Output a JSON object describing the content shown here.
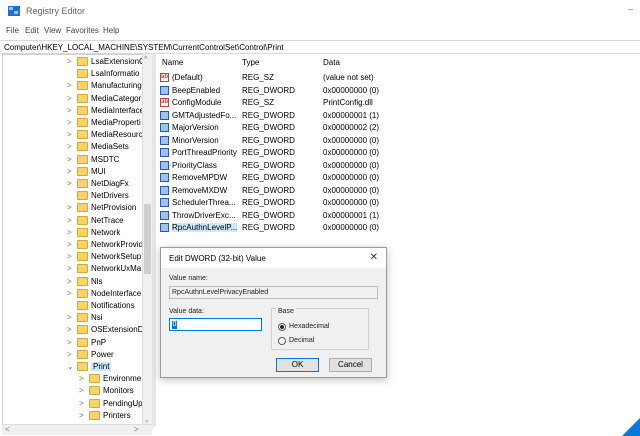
{
  "window": {
    "title": "Registry Editor",
    "controls": "–"
  },
  "menu": [
    "File",
    "Edit",
    "View",
    "Favorites",
    "Help"
  ],
  "address": "Computer\\HKEY_LOCAL_MACHINE\\SYSTEM\\CurrentControlSet\\Control\\Print",
  "tree": {
    "items": [
      {
        "label": "LsaExtensionC",
        "chev": ">"
      },
      {
        "label": "LsaInformatio",
        "chev": ""
      },
      {
        "label": "Manufacturing",
        "chev": ">"
      },
      {
        "label": "MediaCategor",
        "chev": ">"
      },
      {
        "label": "MediaInterface",
        "chev": ">"
      },
      {
        "label": "MediaProperti",
        "chev": ">"
      },
      {
        "label": "MediaResourc",
        "chev": ">"
      },
      {
        "label": "MediaSets",
        "chev": ">"
      },
      {
        "label": "MSDTC",
        "chev": ">"
      },
      {
        "label": "MUI",
        "chev": ">"
      },
      {
        "label": "NetDiagFx",
        "chev": ">"
      },
      {
        "label": "NetDrivers",
        "chev": ""
      },
      {
        "label": "NetProvision",
        "chev": ">"
      },
      {
        "label": "NetTrace",
        "chev": ">"
      },
      {
        "label": "Network",
        "chev": ">"
      },
      {
        "label": "NetworkProvid",
        "chev": ">"
      },
      {
        "label": "NetworkSetup",
        "chev": ">"
      },
      {
        "label": "NetworkUxMa",
        "chev": ">"
      },
      {
        "label": "Nls",
        "chev": ">"
      },
      {
        "label": "NodeInterface",
        "chev": ">"
      },
      {
        "label": "Notifications",
        "chev": ""
      },
      {
        "label": "Nsi",
        "chev": ">"
      },
      {
        "label": "OSExtensionD",
        "chev": ">"
      },
      {
        "label": "PnP",
        "chev": ">"
      },
      {
        "label": "Power",
        "chev": ">"
      },
      {
        "label": "Print",
        "chev": "⌄",
        "selected": true
      },
      {
        "label": "Environme",
        "chev": ">",
        "child": true
      },
      {
        "label": "Monitors",
        "chev": ">",
        "child": true
      },
      {
        "label": "PendingUp",
        "chev": ">",
        "child": true
      },
      {
        "label": "Printers",
        "chev": ">",
        "child": true
      }
    ],
    "scroll_up": "^",
    "scroll_down": "⌄",
    "scroll_left": "<",
    "scroll_right": ">"
  },
  "list": {
    "headers": {
      "name": "Name",
      "type": "Type",
      "data": "Data"
    },
    "rows": [
      {
        "icon": "sz",
        "name": "(Default)",
        "type": "REG_SZ",
        "data": "(value not set)"
      },
      {
        "icon": "bin",
        "name": "BeepEnabled",
        "type": "REG_DWORD",
        "data": "0x00000000 (0)"
      },
      {
        "icon": "sz",
        "name": "ConfigModule",
        "type": "REG_SZ",
        "data": "PrintConfig.dll"
      },
      {
        "icon": "bin",
        "name": "GMTAdjustedFo...",
        "type": "REG_DWORD",
        "data": "0x00000001 (1)"
      },
      {
        "icon": "bin",
        "name": "MajorVersion",
        "type": "REG_DWORD",
        "data": "0x00000002 (2)"
      },
      {
        "icon": "bin",
        "name": "MinorVersion",
        "type": "REG_DWORD",
        "data": "0x00000000 (0)"
      },
      {
        "icon": "bin",
        "name": "PortThreadPriority",
        "type": "REG_DWORD",
        "data": "0x00000000 (0)"
      },
      {
        "icon": "bin",
        "name": "PriorityClass",
        "type": "REG_DWORD",
        "data": "0x00000000 (0)"
      },
      {
        "icon": "bin",
        "name": "RemoveMPDW",
        "type": "REG_DWORD",
        "data": "0x00000000 (0)"
      },
      {
        "icon": "bin",
        "name": "RemoveMXDW",
        "type": "REG_DWORD",
        "data": "0x00000000 (0)"
      },
      {
        "icon": "bin",
        "name": "SchedulerThrea...",
        "type": "REG_DWORD",
        "data": "0x00000000 (0)"
      },
      {
        "icon": "bin",
        "name": "ThrowDriverExc...",
        "type": "REG_DWORD",
        "data": "0x00000001 (1)"
      },
      {
        "icon": "bin",
        "name": "RpcAuthnLevelP...",
        "type": "REG_DWORD",
        "data": "0x00000000 (0)",
        "selected": true
      }
    ]
  },
  "dialog": {
    "title": "Edit DWORD (32-bit) Value",
    "close": "✕",
    "value_name_label": "Value name:",
    "value_name": "RpcAuthnLevelPrivacyEnabled",
    "value_data_label": "Value data:",
    "value_data": "0",
    "base_label": "Base",
    "base_options": [
      {
        "label": "Hexadecimal",
        "checked": true
      },
      {
        "label": "Decimal",
        "checked": false
      }
    ],
    "ok": "OK",
    "cancel": "Cancel"
  },
  "colors": {
    "accent": "#0078d7",
    "selection": "#cce8ff",
    "folder": "#f6d36b"
  }
}
